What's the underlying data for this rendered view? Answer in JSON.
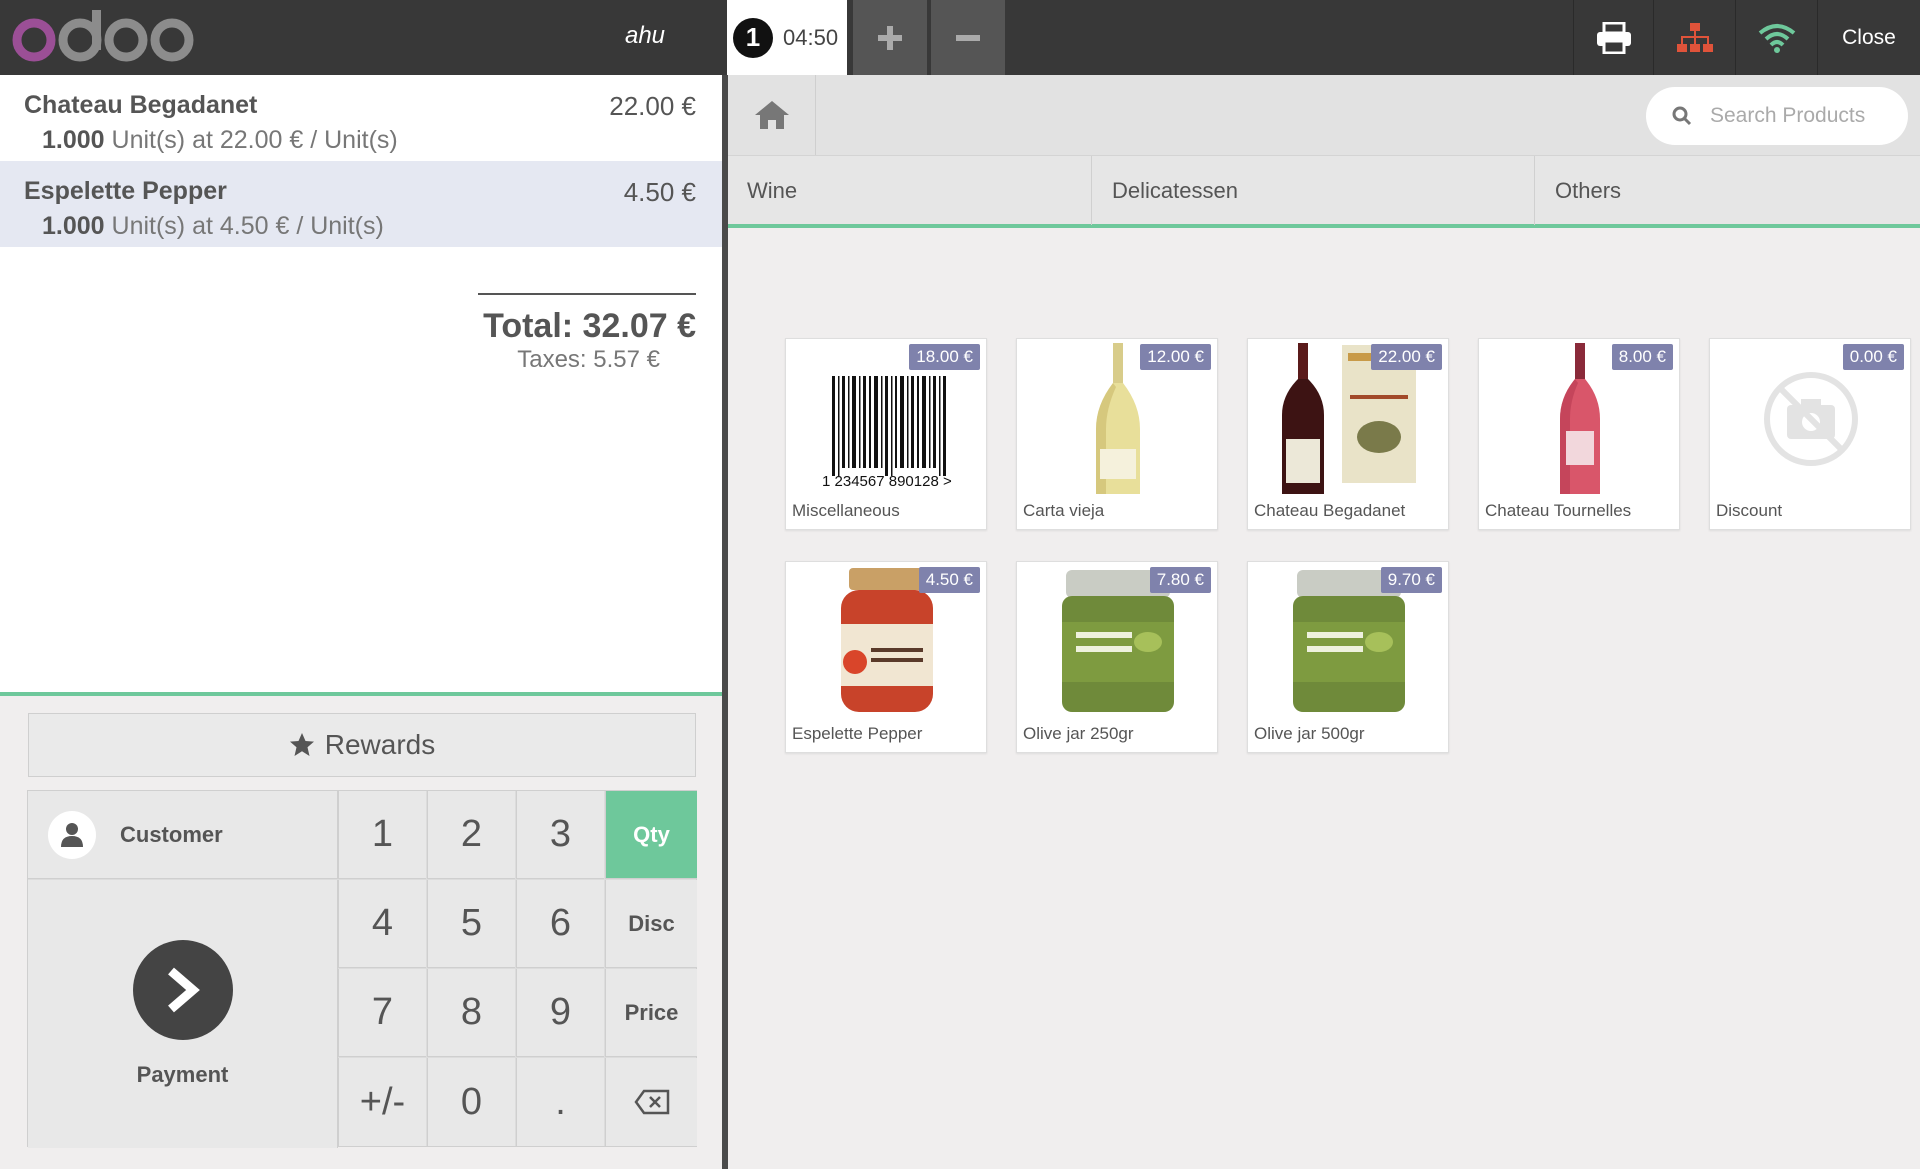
{
  "header": {
    "brand": "odoo",
    "username": "ahu",
    "order_number": "1",
    "order_time": "04:50",
    "close_label": "Close",
    "icons": [
      "add-order-icon",
      "remove-order-icon",
      "printer-icon",
      "network-icon",
      "wifi-icon"
    ],
    "colors": {
      "logo_o": "#9b4f96",
      "network": "#e0533a",
      "wifi": "#6ec89b"
    }
  },
  "order": {
    "lines": [
      {
        "name": "Chateau Begadanet",
        "price": "22.00 €",
        "qty": "1.000",
        "info": "Unit(s) at 22.00 € / Unit(s)"
      },
      {
        "name": "Espelette Pepper",
        "price": "4.50 €",
        "qty": "1.000",
        "info": "Unit(s) at 4.50 € / Unit(s)"
      }
    ],
    "total": "Total: 32.07 €",
    "taxes": "Taxes: 5.57 €"
  },
  "actions": {
    "rewards_label": "Rewards",
    "customer_label": "Customer",
    "payment_label": "Payment"
  },
  "keypad": {
    "digits": [
      "1",
      "2",
      "3",
      "4",
      "5",
      "6",
      "7",
      "8",
      "9",
      "+/-",
      "0",
      "."
    ],
    "modes": [
      "Qty",
      "Disc",
      "Price"
    ],
    "active_mode": "Qty",
    "accent": "#6ec89b"
  },
  "catalog": {
    "search_placeholder": "Search Products",
    "categories": [
      "Wine",
      "Delicatessen",
      "Others"
    ],
    "products": [
      {
        "name": "Miscellaneous",
        "price": "18.00 €",
        "image": "barcode",
        "barcode_text": "1 234567 890128 >"
      },
      {
        "name": "Carta vieja",
        "price": "12.00 €",
        "image": "white-wine-bottle"
      },
      {
        "name": "Chateau Begadanet",
        "price": "22.00 €",
        "image": "red-wine-bottle"
      },
      {
        "name": "Chateau Tournelles",
        "price": "8.00 €",
        "image": "rose-wine-bottle"
      },
      {
        "name": "Discount",
        "price": "0.00 €",
        "image": "no-photo"
      },
      {
        "name": "Espelette Pepper",
        "price": "4.50 €",
        "image": "pepper-jar"
      },
      {
        "name": "Olive jar 250gr",
        "price": "7.80 €",
        "image": "olive-jar"
      },
      {
        "name": "Olive jar 500gr",
        "price": "9.70 €",
        "image": "olive-jar"
      }
    ],
    "price_badge_color": "#7f82ac"
  }
}
